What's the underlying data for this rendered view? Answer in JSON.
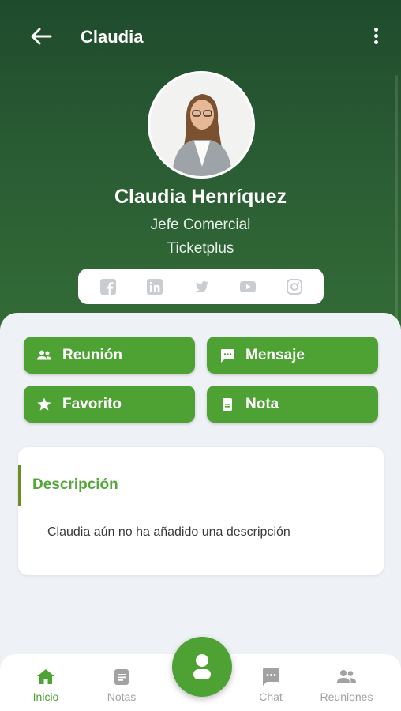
{
  "header": {
    "title": "Claudia"
  },
  "profile": {
    "name": "Claudia Henríquez",
    "role": "Jefe Comercial",
    "company": "Ticketplus"
  },
  "social": [
    "facebook-icon",
    "linkedin-icon",
    "twitter-icon",
    "youtube-icon",
    "instagram-icon"
  ],
  "actions": {
    "meeting": "Reunión",
    "message": "Mensaje",
    "favorite": "Favorito",
    "note": "Nota"
  },
  "description": {
    "title": "Descripción",
    "text": "Claudia aún no ha añadido una descripción"
  },
  "nav": {
    "home": "Inicio",
    "notes": "Notas",
    "chat": "Chat",
    "meetings": "Reuniones"
  },
  "colors": {
    "accent": "#4ea234",
    "header_top": "#1f4b2d",
    "header_bottom": "#336c37"
  }
}
